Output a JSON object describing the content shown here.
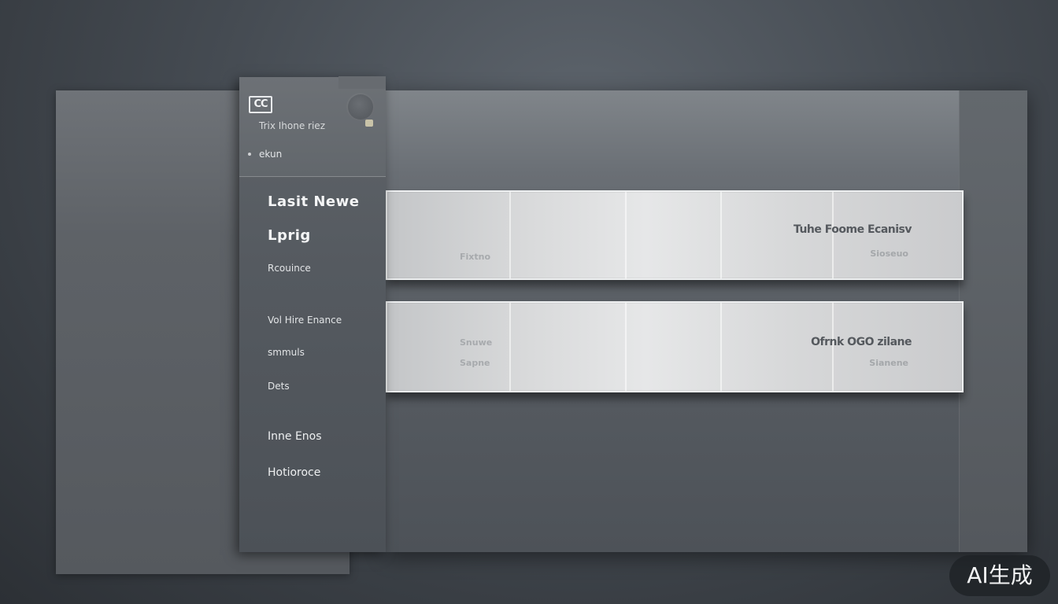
{
  "sidebar": {
    "logo_text": "CC",
    "header_subtitle": "Trix Ihone riez",
    "header_label": "ekun",
    "items": [
      {
        "label": "Lasit Newe"
      },
      {
        "label": "Lprig"
      },
      {
        "label": "Rcouince"
      },
      {
        "label": "Vol Hire Enance"
      },
      {
        "label": "smmuls"
      },
      {
        "label": "Dets"
      },
      {
        "label": "Inne Enos"
      },
      {
        "label": "Hotioroce"
      }
    ]
  },
  "cards": [
    {
      "title": "Tuhe Foome Ecanisv",
      "meta_left": "Fixtno",
      "meta_right": "Sioseuo"
    },
    {
      "title": "Ofrnk OGO zilane",
      "meta_left": "Snuwe",
      "meta_left_2": "Sapne",
      "meta_right": "Sianene"
    }
  ],
  "watermark": "AI生成"
}
